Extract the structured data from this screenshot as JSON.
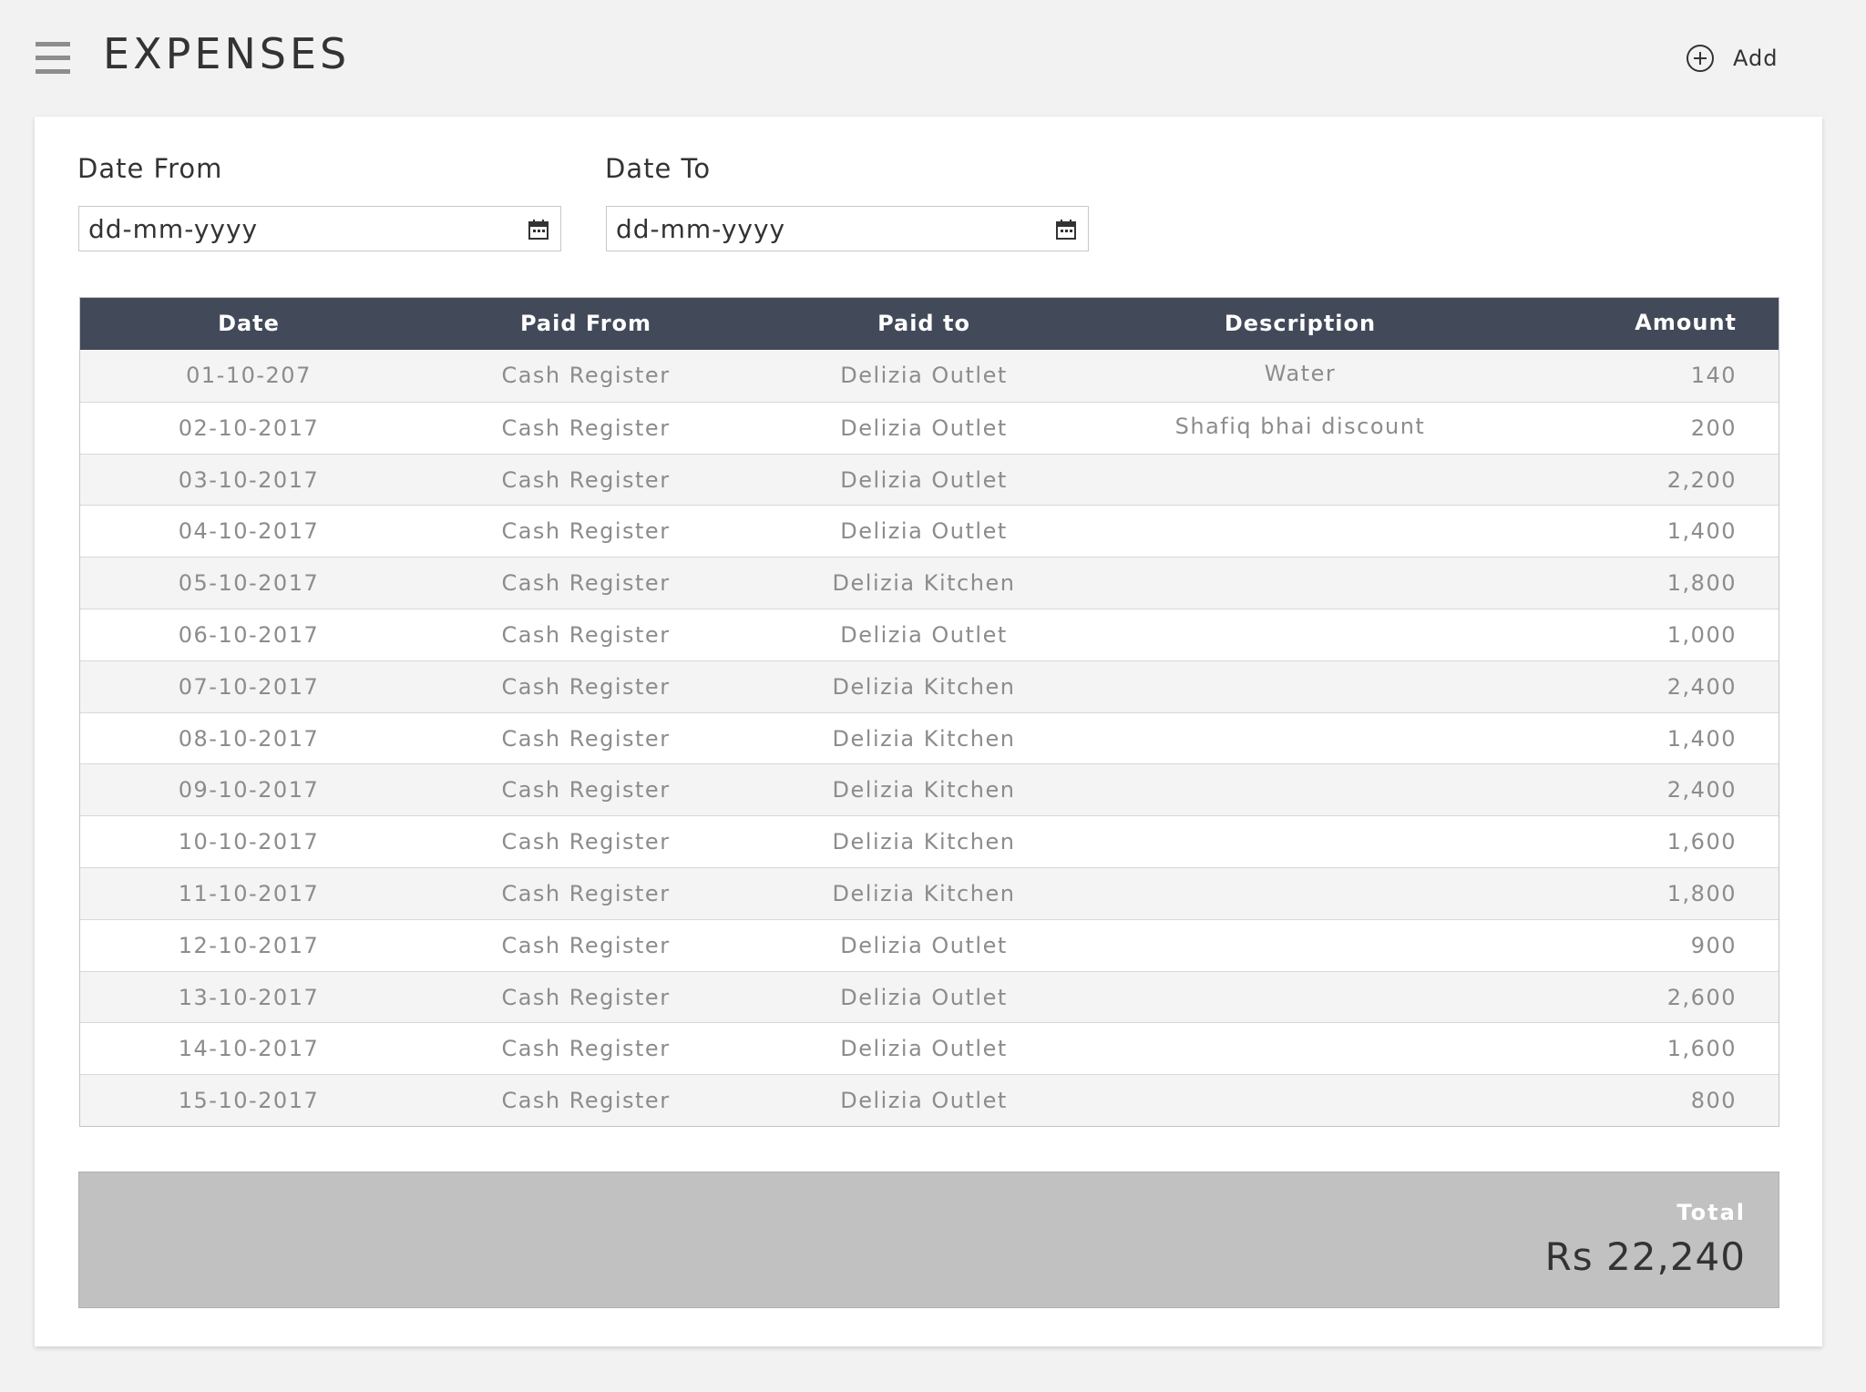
{
  "header": {
    "title": "EXPENSES",
    "menu_icon": "hamburger-menu-icon",
    "add_label": "Add",
    "add_icon": "plus-circle-icon"
  },
  "filters": {
    "date_from": {
      "label": "Date From",
      "value": "dd-mm-yyyy",
      "icon": "calendar-icon"
    },
    "date_to": {
      "label": "Date To",
      "value": "dd-mm-yyyy",
      "icon": "calendar-icon"
    }
  },
  "table": {
    "columns": [
      "Date",
      "Paid From",
      "Paid to",
      "Description",
      "Amount"
    ],
    "rows": [
      {
        "date": "01-10-207",
        "from": "Cash Register",
        "to": "Delizia Outlet",
        "desc": "Water",
        "amount": "140"
      },
      {
        "date": "02-10-2017",
        "from": "Cash Register",
        "to": "Delizia Outlet",
        "desc": "Shafiq bhai discount",
        "amount": "200"
      },
      {
        "date": "03-10-2017",
        "from": "Cash Register",
        "to": "Delizia Outlet",
        "desc": "",
        "amount": "2,200"
      },
      {
        "date": "04-10-2017",
        "from": "Cash Register",
        "to": "Delizia Outlet",
        "desc": "",
        "amount": "1,400"
      },
      {
        "date": "05-10-2017",
        "from": "Cash Register",
        "to": "Delizia Kitchen",
        "desc": "",
        "amount": "1,800"
      },
      {
        "date": "06-10-2017",
        "from": "Cash Register",
        "to": "Delizia Outlet",
        "desc": "",
        "amount": "1,000"
      },
      {
        "date": "07-10-2017",
        "from": "Cash Register",
        "to": "Delizia Kitchen",
        "desc": "",
        "amount": "2,400"
      },
      {
        "date": "08-10-2017",
        "from": "Cash Register",
        "to": "Delizia Kitchen",
        "desc": "",
        "amount": "1,400"
      },
      {
        "date": "09-10-2017",
        "from": "Cash Register",
        "to": "Delizia Kitchen",
        "desc": "",
        "amount": "2,400"
      },
      {
        "date": "10-10-2017",
        "from": "Cash Register",
        "to": "Delizia Kitchen",
        "desc": "",
        "amount": "1,600"
      },
      {
        "date": "11-10-2017",
        "from": "Cash Register",
        "to": "Delizia Kitchen",
        "desc": "",
        "amount": "1,800"
      },
      {
        "date": "12-10-2017",
        "from": "Cash Register",
        "to": "Delizia Outlet",
        "desc": "",
        "amount": "900"
      },
      {
        "date": "13-10-2017",
        "from": "Cash Register",
        "to": "Delizia Outlet",
        "desc": "",
        "amount": "2,600"
      },
      {
        "date": "14-10-2017",
        "from": "Cash Register",
        "to": "Delizia Outlet",
        "desc": "",
        "amount": "1,600"
      },
      {
        "date": "15-10-2017",
        "from": "Cash Register",
        "to": "Delizia Outlet",
        "desc": "",
        "amount": "800"
      }
    ]
  },
  "total": {
    "label": "Total",
    "value": "Rs 22,240"
  },
  "colors": {
    "table_header": "#424959",
    "page_bg": "#f2f2f2",
    "total_bg": "#c1c1c1"
  }
}
